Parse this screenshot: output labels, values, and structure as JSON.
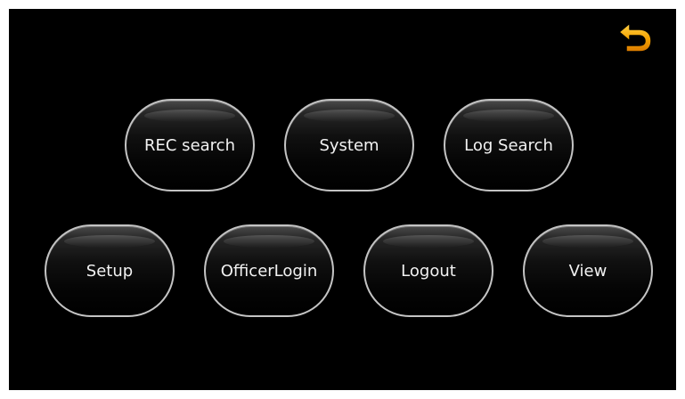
{
  "icons": {
    "back": "back-arrow-icon"
  },
  "colors": {
    "background": "#000000",
    "button_border": "#c4c4c4",
    "button_text": "#f2f2f2",
    "back_icon": "#f5a300"
  },
  "menu": {
    "row1": [
      "REC search",
      "System",
      "Log Search"
    ],
    "row2": [
      "Setup",
      "OfficerLogin",
      "Logout",
      "View"
    ]
  }
}
